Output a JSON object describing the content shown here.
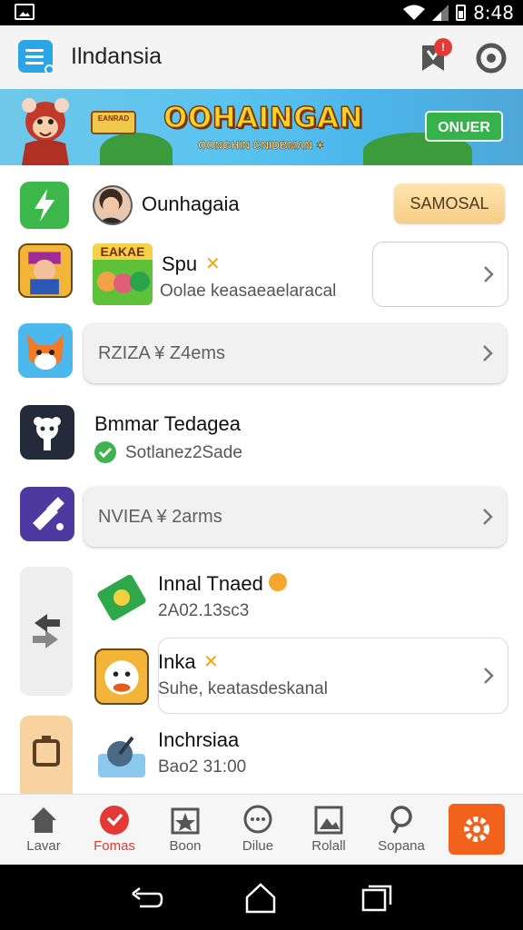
{
  "status_bar": {
    "time": "8:48"
  },
  "app_bar": {
    "title": "Ilndansia",
    "notification_count": "!"
  },
  "banner": {
    "title": "OOHAINGAN",
    "subtitle": "OONGHIN CNIDBMAN ✶",
    "cta_label": "ONUER",
    "logo_text": "EANRAD"
  },
  "rows": {
    "profile": {
      "name": "Ounhagaia",
      "action_label": "SAMOSAL"
    },
    "game1": {
      "thumb_label": "EAKAE",
      "name": "Spu",
      "sub": "Oolae keasaeaelaracal"
    },
    "pill1": {
      "text": "RZIZA ¥ Z4ems"
    },
    "team": {
      "name": "Bmmar Tedagea",
      "sub": "Sotlanez2Sade"
    },
    "pill2": {
      "text": "NVIEA ¥ 2arms"
    },
    "trade": {
      "name": "Innal Tnaed",
      "sub": "2A02.13sc3"
    },
    "game2": {
      "name": "Inka",
      "sub": "Suhe, keatasdeskanal"
    },
    "indch": {
      "name": "Inchrsiaa",
      "sub": "Bao2 31:00"
    }
  },
  "bottom_nav": [
    {
      "label": "Lavar",
      "icon": "home-icon"
    },
    {
      "label": "Fomas",
      "icon": "heart-badge-icon",
      "active": true
    },
    {
      "label": "Boon",
      "icon": "star-box-icon"
    },
    {
      "label": "Dilue",
      "icon": "chat-bubble-icon"
    },
    {
      "label": "Rolall",
      "icon": "image-frame-icon"
    },
    {
      "label": "Sopana",
      "icon": "search-icon"
    }
  ],
  "colors": {
    "accent_blue": "#2aa5e6",
    "active_red": "#e53935",
    "fab_orange": "#f2621d",
    "check_green": "#3fb34f"
  }
}
